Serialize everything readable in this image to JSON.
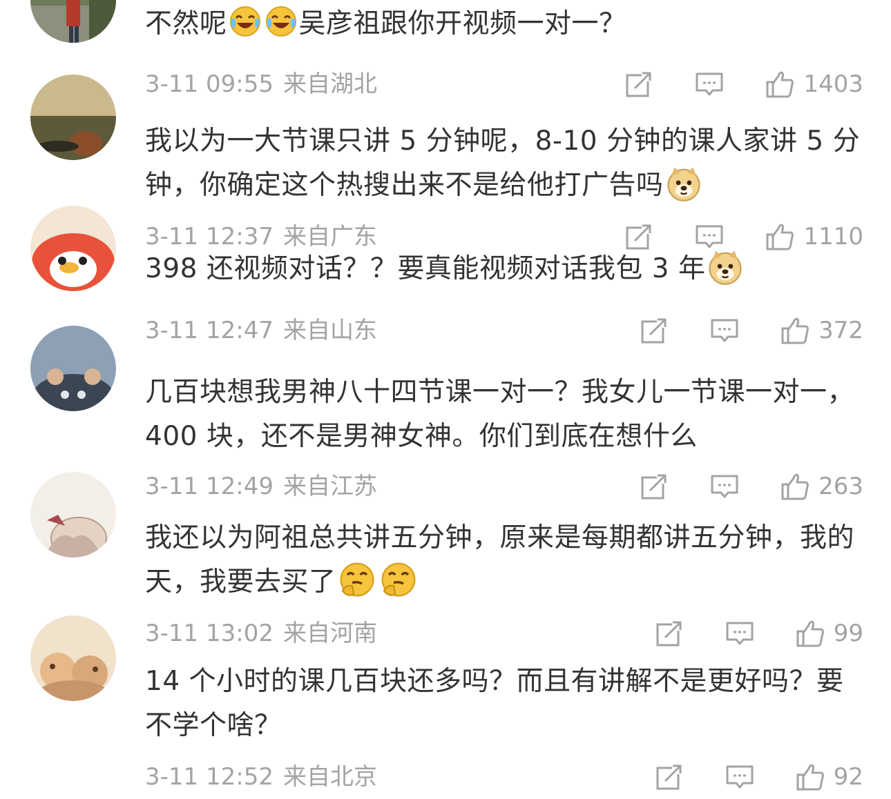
{
  "comments": [
    {
      "text_before": "不然呢",
      "emoji_mid": [
        "laugh-cry-emoji",
        "laugh-cry-emoji"
      ],
      "text_after": "吴彦祖跟你开视频一对一？",
      "time": "3-11 09:55",
      "region": "来自湖北",
      "likes": "1403"
    },
    {
      "text": "我以为一大节课只讲 5 分钟呢，8-10 分钟的课人家讲 5 分钟，你确定这个热搜出来不是给他打广告吗",
      "emoji_end": "doge-emoji",
      "time": "3-11 12:37",
      "region": "来自广东",
      "likes": "1110"
    },
    {
      "text": "398 还视频对话？？要真能视频对话我包 3 年",
      "emoji_end": "doge-emoji",
      "time": "3-11 12:47",
      "region": "来自山东",
      "likes": "372"
    },
    {
      "text": "几百块想我男神八十四节课一对一？我女儿一节课一对一，400 块，还不是男神女神。你们到底在想什么",
      "time": "3-11 12:49",
      "region": "来自江苏",
      "likes": "263"
    },
    {
      "text": "我还以为阿祖总共讲五分钟，原来是每期都讲五分钟，我的天，我要去买了",
      "emoji_end": "thinking-emoji",
      "time": "3-11 13:02",
      "region": "来自河南",
      "likes": "99"
    },
    {
      "text": "14 个小时的课几百块还多吗？而且有讲解不是更好吗？要不学个啥？",
      "time": "3-11 12:52",
      "region": "来自北京",
      "likes": "92"
    }
  ],
  "icons": {
    "share": "share-icon",
    "reply": "reply-icon",
    "like": "thumbs-up-icon"
  },
  "colors": {
    "text": "#333333",
    "meta": "#a3a3a3",
    "background": "#ffffff",
    "emoji": "#f7c53c"
  }
}
